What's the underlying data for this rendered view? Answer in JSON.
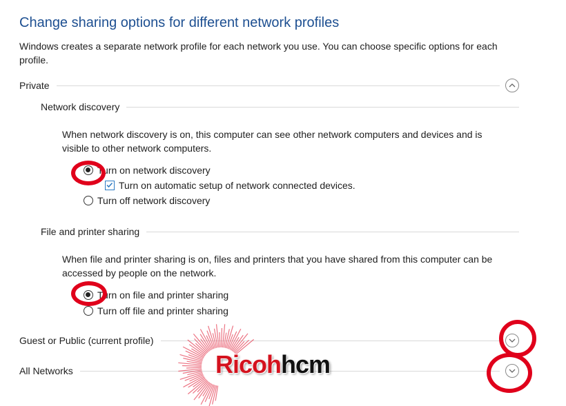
{
  "title": "Change sharing options for different network profiles",
  "intro": "Windows creates a separate network profile for each network you use. You can choose specific options for each profile.",
  "private": {
    "label": "Private",
    "network_discovery": {
      "label": "Network discovery",
      "description": "When network discovery is on, this computer can see other network computers and devices and is visible to other network computers.",
      "options": {
        "on": "Turn on network discovery",
        "auto_setup": "Turn on automatic setup of network connected devices.",
        "off": "Turn off network discovery"
      },
      "selected": "on",
      "auto_setup_checked": true
    },
    "file_sharing": {
      "label": "File and printer sharing",
      "description": "When file and printer sharing is on, files and printers that you have shared from this computer can be accessed by people on the network.",
      "options": {
        "on": "Turn on file and printer sharing",
        "off": "Turn off file and printer sharing"
      },
      "selected": "on"
    }
  },
  "guest_public": {
    "label": "Guest or Public (current profile)"
  },
  "all_networks": {
    "label": "All Networks"
  },
  "watermark": {
    "part1": "Ricoh",
    "part2": "hcm"
  },
  "icons": {
    "collapse": "chevron-up-icon",
    "expand": "chevron-down-icon"
  },
  "colors": {
    "title": "#1d4f91",
    "annotation": "#e0001b",
    "checkbox": "#2b79c2"
  }
}
